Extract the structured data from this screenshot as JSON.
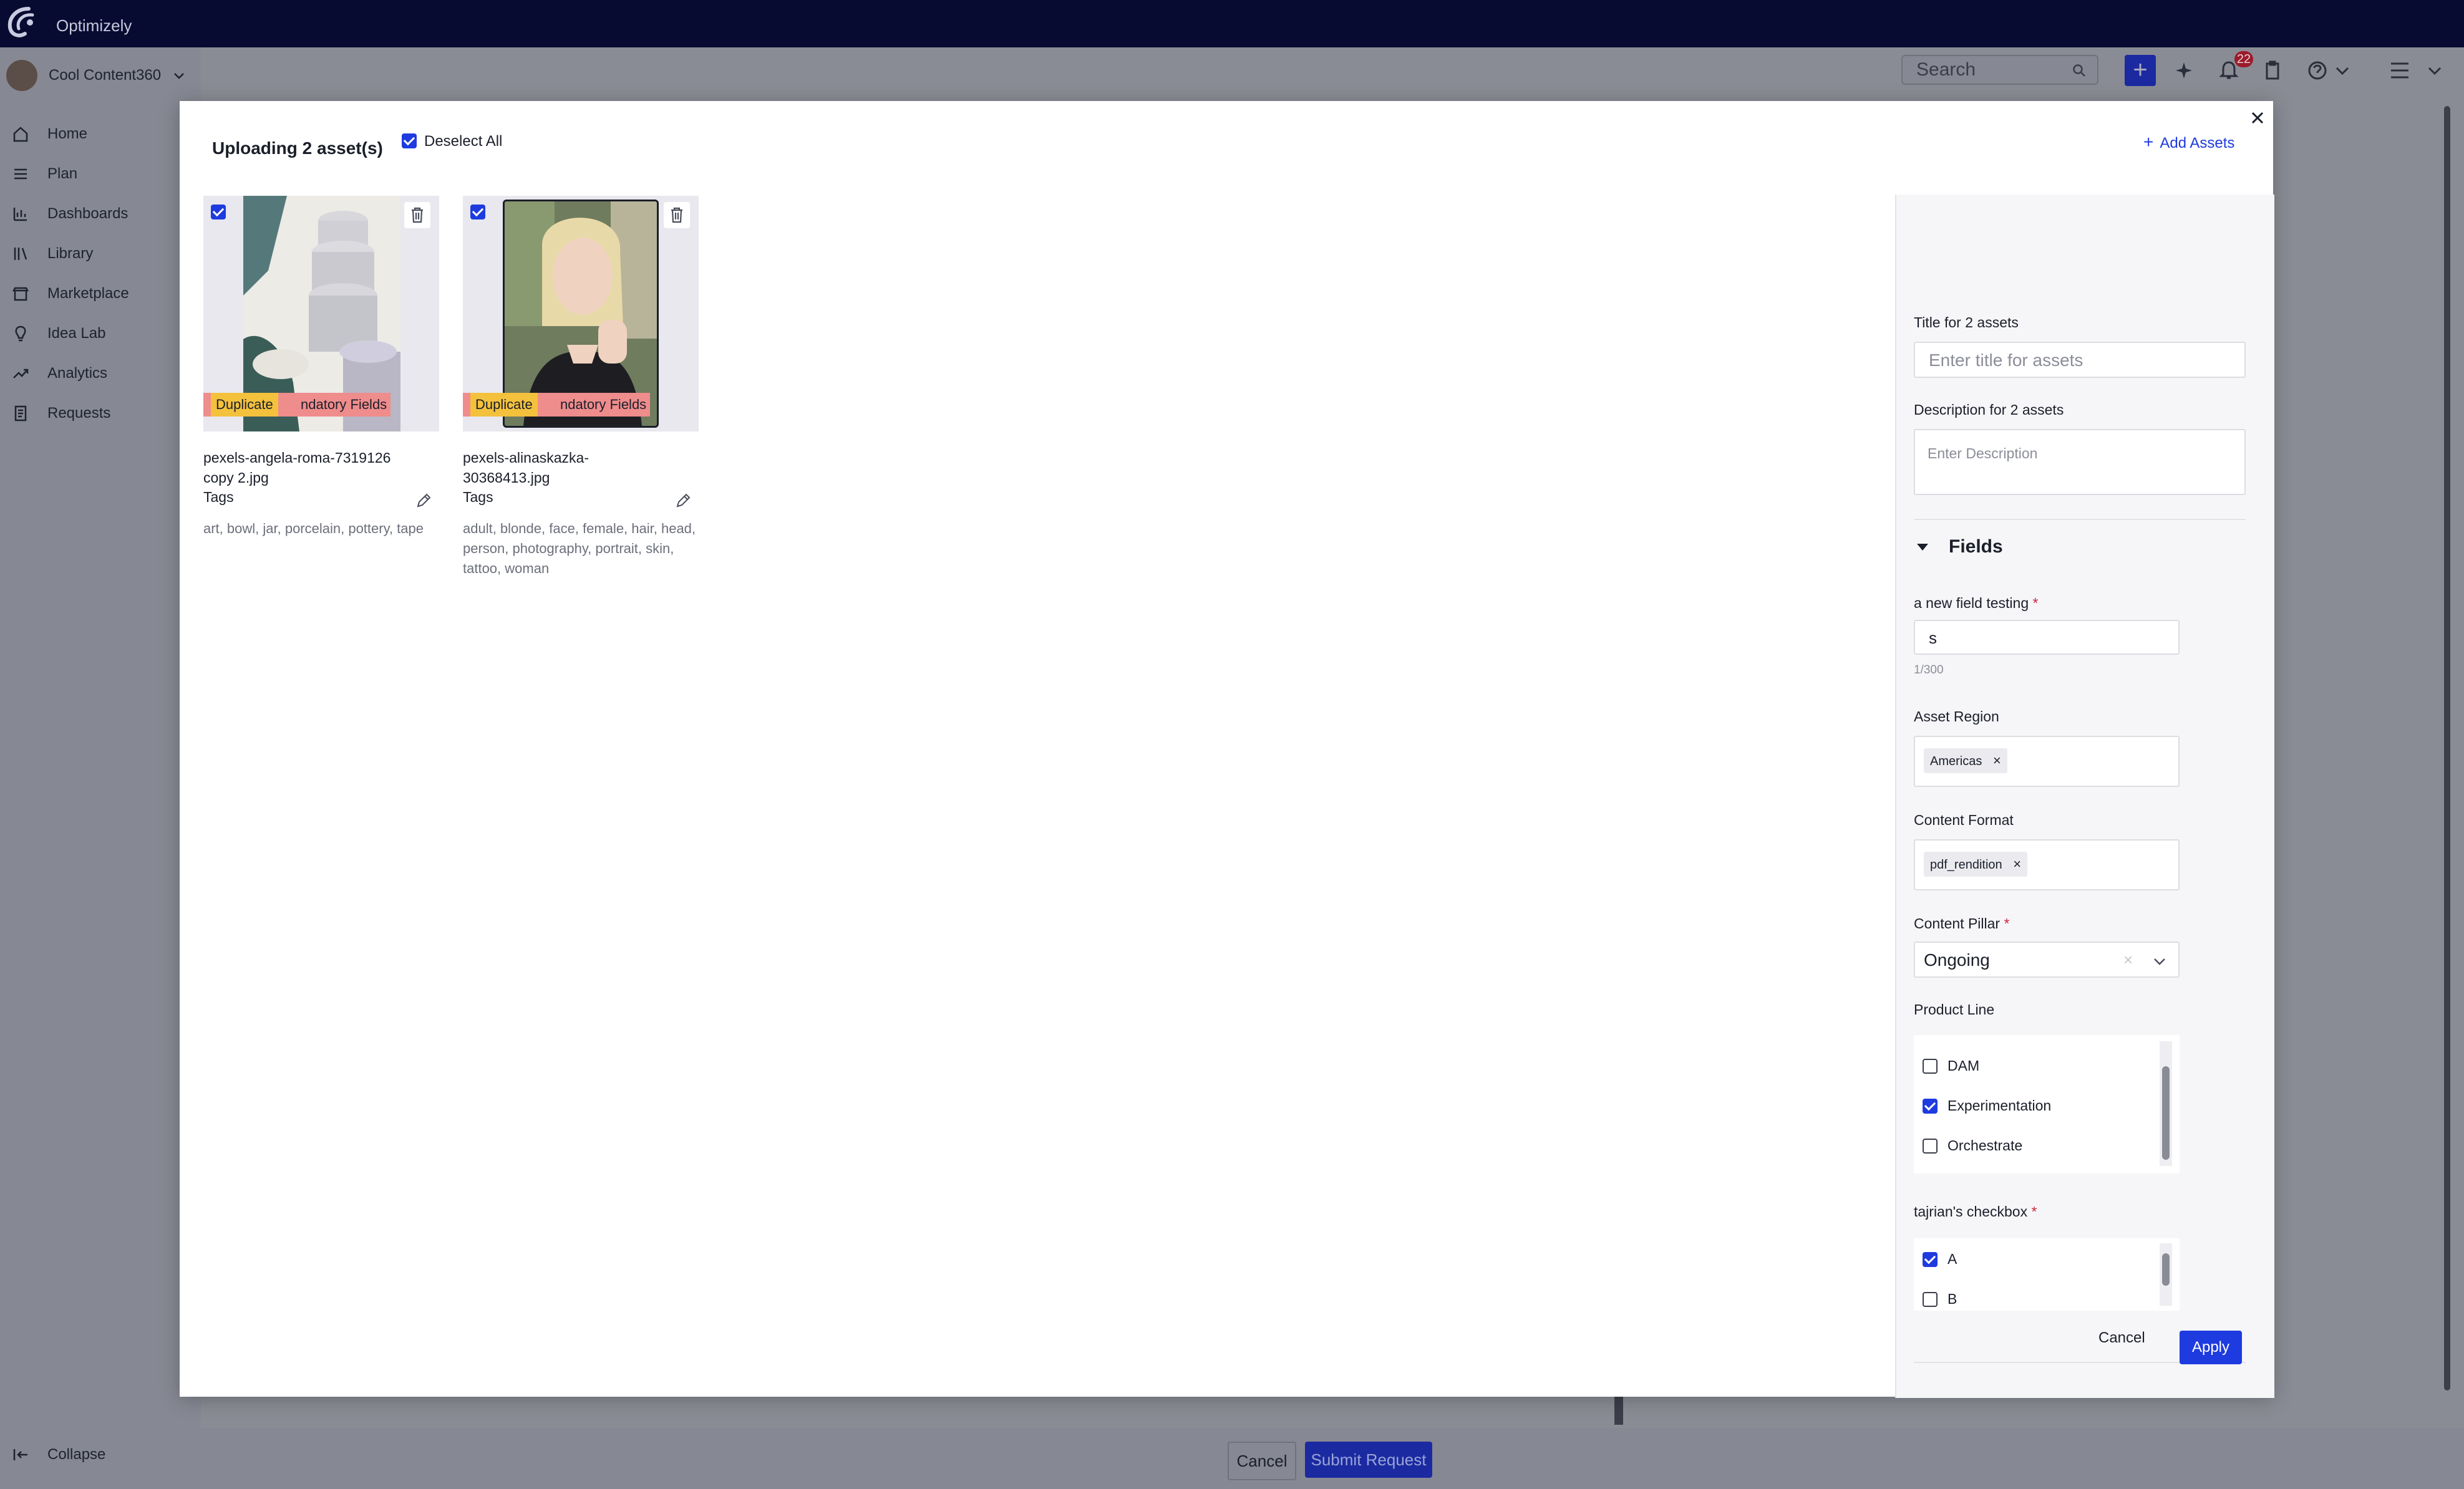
{
  "topbar": {
    "brand": "Optimizely"
  },
  "workspace": {
    "name": "Cool Content360"
  },
  "sidebar": {
    "items": [
      {
        "label": "Home"
      },
      {
        "label": "Plan"
      },
      {
        "label": "Dashboards"
      },
      {
        "label": "Library"
      },
      {
        "label": "Marketplace"
      },
      {
        "label": "Idea Lab"
      },
      {
        "label": "Analytics"
      },
      {
        "label": "Requests"
      }
    ],
    "collapse": "Collapse"
  },
  "header": {
    "search_placeholder": "Search",
    "notification_count": "22"
  },
  "bottom": {
    "cancel": "Cancel",
    "submit": "Submit Request"
  },
  "modal": {
    "title": "Uploading 2 asset(s)",
    "deselect_all": "Deselect All",
    "add_assets": "Add Assets",
    "cards": [
      {
        "filename": "pexels-angela-roma-7319126 copy 2.jpg",
        "tags_label": "Tags",
        "tags": "art, bowl, jar, porcelain, pottery, tape",
        "duplicate_label": "Duplicate",
        "error_label": "Mandatory Fields",
        "error_visible_fragment": "ndatory Fields"
      },
      {
        "filename": "pexels-alinaskazka-30368413.jpg",
        "tags_label": "Tags",
        "tags": "adult, blonde, face, female, hair, head, person, photography, portrait, skin, tattoo, woman",
        "duplicate_label": "Duplicate",
        "error_label": "Mandatory Fields",
        "error_visible_fragment": "ndatory Fields"
      }
    ],
    "panel": {
      "title_label": "Title for 2 assets",
      "title_placeholder": "Enter title for assets",
      "description_label": "Description for 2 assets",
      "description_placeholder": "Enter Description",
      "fields_heading": "Fields",
      "new_field": {
        "label": "a new field testing",
        "value": "s",
        "counter": "1/300"
      },
      "asset_region": {
        "label": "Asset Region",
        "chips": [
          "Americas"
        ]
      },
      "content_format": {
        "label": "Content Format",
        "chips": [
          "pdf_rendition"
        ]
      },
      "content_pillar": {
        "label": "Content Pillar",
        "value": "Ongoing"
      },
      "product_line": {
        "label": "Product Line",
        "options": [
          {
            "label": "DAM",
            "checked": false
          },
          {
            "label": "Experimentation",
            "checked": true
          },
          {
            "label": "Orchestrate",
            "checked": false
          }
        ]
      },
      "tajrian_checkbox": {
        "label": "tajrian's checkbox",
        "options": [
          {
            "label": "A",
            "checked": true
          },
          {
            "label": "B",
            "checked": false
          }
        ]
      }
    },
    "footer": {
      "cancel": "Cancel",
      "apply": "Apply"
    }
  },
  "colors": {
    "primary": "#1e3be0",
    "topbar": "#070b32",
    "duplicate": "#f4c13d",
    "error": "#ef8c8c",
    "required": "#d0243c"
  }
}
